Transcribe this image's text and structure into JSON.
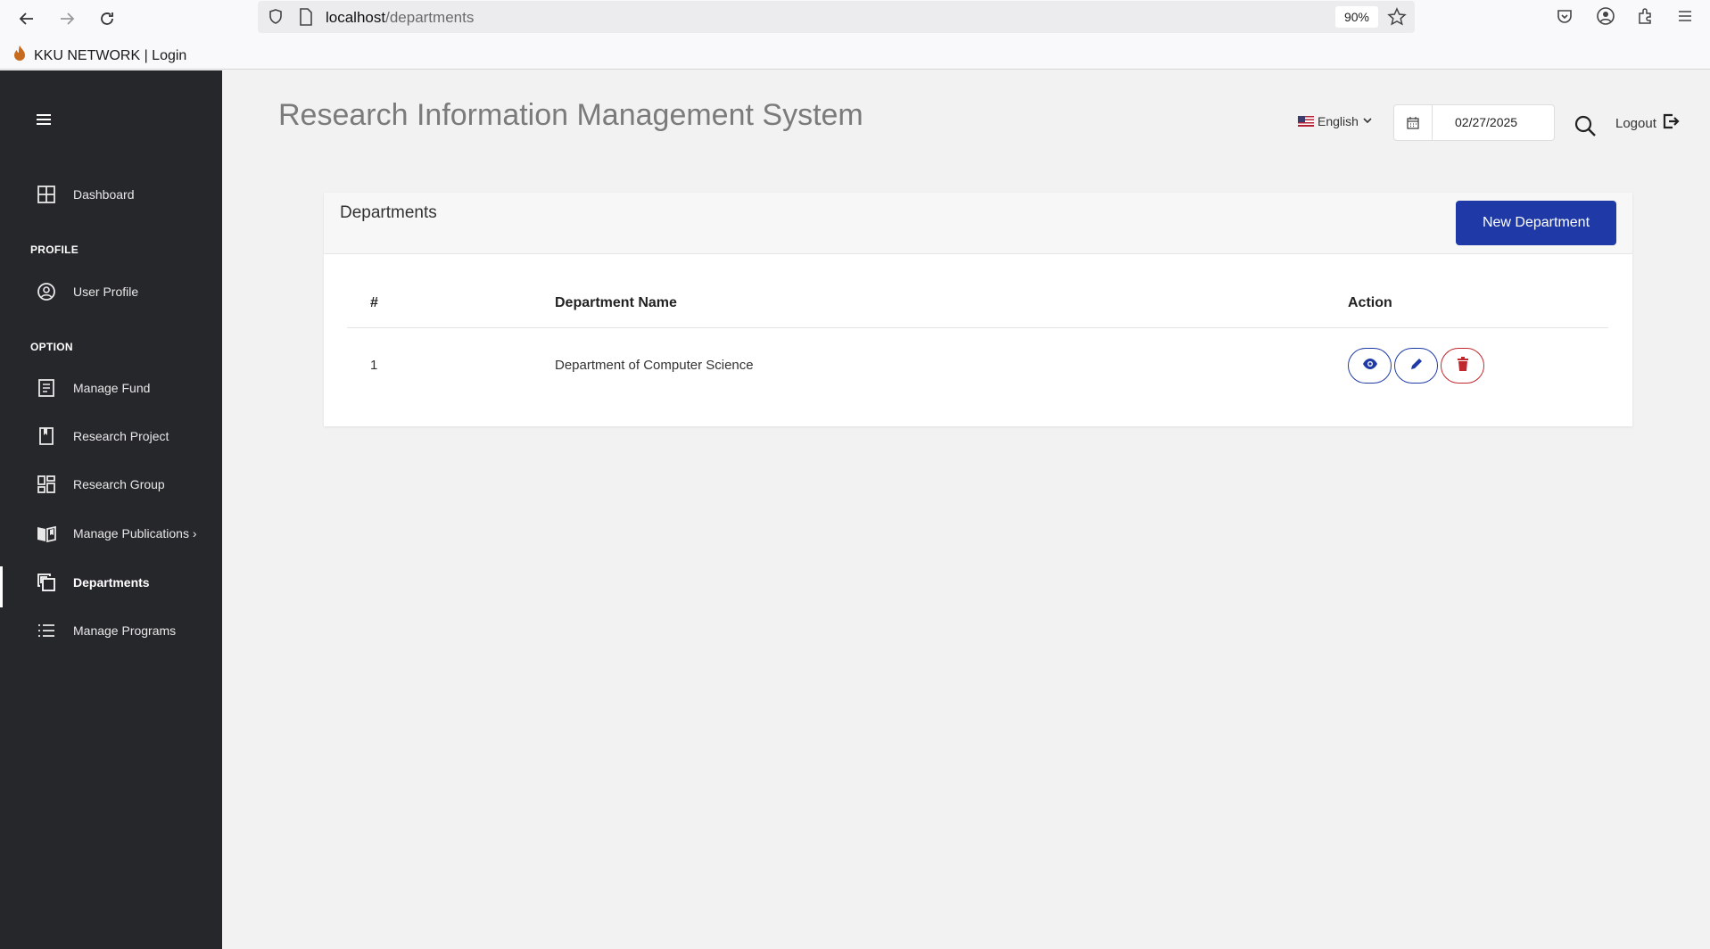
{
  "browser": {
    "url_host": "localhost",
    "url_path": "/departments",
    "zoom": "90%",
    "bookmark_label": "KKU NETWORK | Login"
  },
  "sidebar": {
    "items": [
      {
        "label": "Dashboard",
        "icon": "grid-icon"
      },
      {
        "label": "User Profile",
        "icon": "user-circle-icon"
      },
      {
        "label": "Manage Fund",
        "icon": "document-icon"
      },
      {
        "label": "Research Project",
        "icon": "bookmark-icon"
      },
      {
        "label": "Research Group",
        "icon": "dashboard-grid-icon"
      },
      {
        "label": "Manage Publications ›",
        "icon": "book-open-icon"
      },
      {
        "label": "Departments",
        "icon": "copy-icon",
        "active": true
      },
      {
        "label": "Manage Programs",
        "icon": "list-icon"
      }
    ],
    "sections": [
      "PROFILE",
      "OPTION"
    ]
  },
  "header": {
    "title": "Research Information Management System",
    "language": "English",
    "date": "02/27/2025",
    "logout": "Logout"
  },
  "card": {
    "title": "Departments",
    "new_button": "New Department",
    "columns": [
      "#",
      "Department Name",
      "Action"
    ],
    "rows": [
      {
        "index": "1",
        "name": "Department of Computer Science"
      }
    ]
  },
  "colors": {
    "sidebar_bg": "#26272b",
    "primary": "#1f3aa6",
    "danger": "#c0282d"
  }
}
